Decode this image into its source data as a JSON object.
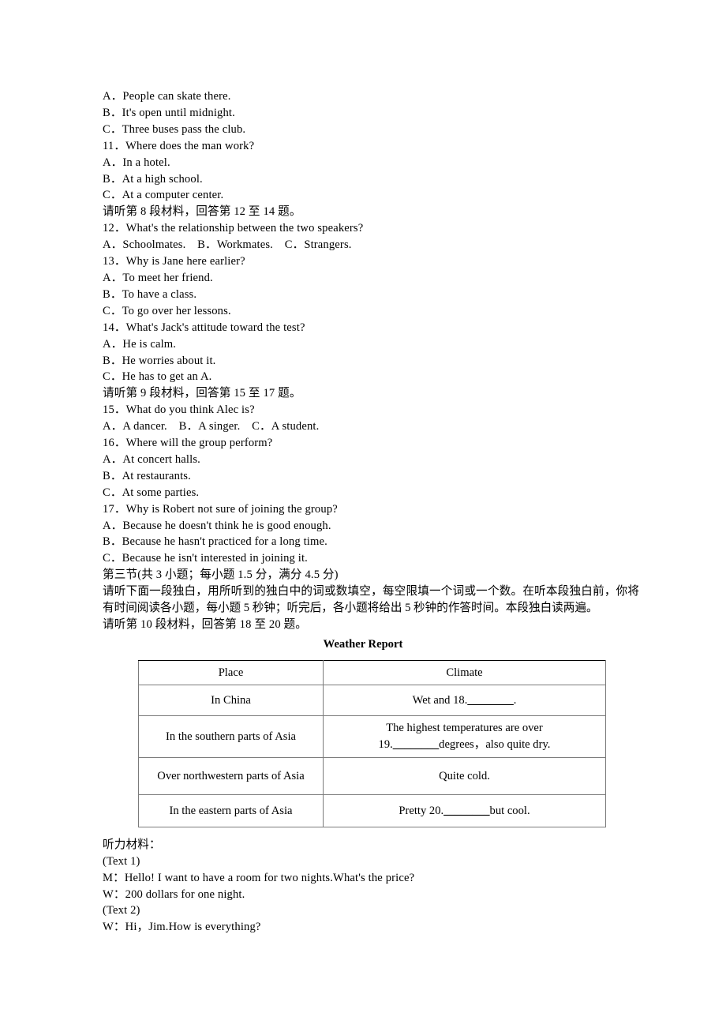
{
  "document": {
    "type": "english-exam-listening-section",
    "lines_top": [
      "A．People can skate there.",
      "B．It's open until midnight.",
      "C．Three buses pass the club.",
      "11．Where does the man work?",
      "A．In a hotel.",
      "B．At a high school.",
      "C．At a computer center.",
      "请听第 8 段材料，回答第 12 至 14 题。",
      "12．What's the relationship between the two speakers?",
      "A．Schoolmates.　B．Workmates.　C．Strangers.",
      "13．Why is Jane here earlier?",
      "A．To meet her friend.",
      "B．To have a class.",
      "C．To go over her lessons.",
      "14．What's Jack's attitude toward the test?",
      "A．He is calm.",
      "B．He worries about it.",
      "C．He has to get an A.",
      "请听第 9 段材料，回答第 15 至 17 题。",
      "15．What do you think Alec is?",
      "A．A dancer.　B．A singer.　C．A student.",
      "16．Where will the group perform?",
      "A．At concert halls.",
      "B．At restaurants.",
      "C．At some parties.",
      "17．Why is Robert not sure of joining the group?",
      "A．Because he doesn't think he is good enough.",
      "B．Because he hasn't practiced for a long time.",
      "C．Because he isn't interested in joining it.",
      "第三节(共 3 小题；每小题 1.5 分，满分 4.5 分)"
    ],
    "instruction_paragraph": "请听下面一段独白，用所听到的独白中的词或数填空，每空限填一个词或一个数。在听本段独白前，你将有时间阅读各小题，每小题 5 秒钟；听完后，各小题将给出 5 秒钟的作答时间。本段独白读两遍。",
    "section_intro": "请听第 10 段材料，回答第 18 至 20 题。",
    "table": {
      "title": "Weather Report",
      "headers": [
        "Place",
        "Climate"
      ],
      "rows": [
        {
          "place": "In China",
          "climate_prefix": "Wet and 18.",
          "climate_blank": "________",
          "climate_suffix": "."
        },
        {
          "place": "In the southern parts of Asia",
          "climate_line1": "The highest temperatures are over",
          "climate_prefix": "19.",
          "climate_blank": "________",
          "climate_suffix": "degrees，also quite dry."
        },
        {
          "place": "Over northwestern parts of Asia",
          "climate_prefix": "Quite cold.",
          "climate_blank": "",
          "climate_suffix": ""
        },
        {
          "place": "In the eastern parts of Asia",
          "climate_prefix": "Pretty 20.",
          "climate_blank": "________",
          "climate_suffix": "but cool."
        }
      ]
    },
    "transcript": {
      "heading": "听力材料：",
      "lines": [
        "(Text 1)",
        "M：Hello! I want to have a room for two nights.What's the price?",
        "W：200 dollars for one night.",
        "(Text 2)",
        "W：Hi，Jim.How is everything?"
      ]
    }
  }
}
